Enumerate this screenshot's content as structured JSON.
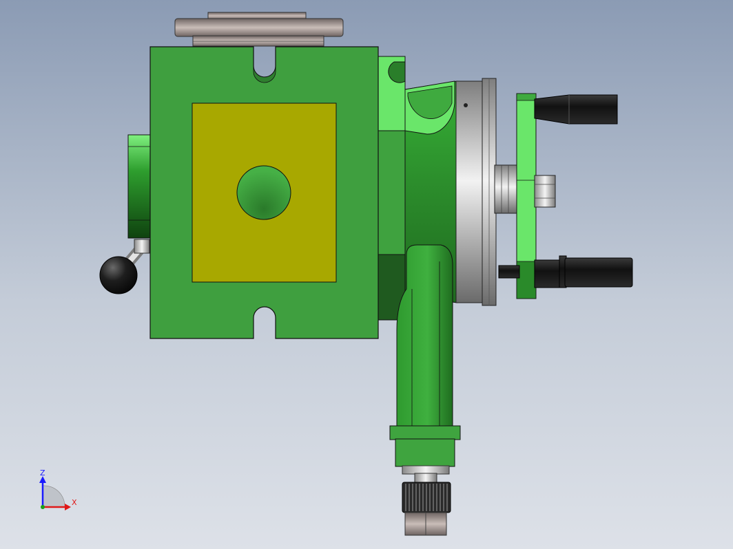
{
  "viewport": {
    "background_top": "#8b9bb4",
    "background_bottom": "#dde1e8"
  },
  "model": {
    "colors": {
      "body_green": "#3f9f3f",
      "light_green": "#66e266",
      "dark_green": "#1f5f1f",
      "olive_face": "#a8a800",
      "steel": "#b9b9b9",
      "cast_grey": "#9a8f8a",
      "knob_black": "#1c1c1c"
    }
  },
  "triad": {
    "z_label": "Z",
    "x_label": "X",
    "z_color": "#1a1aff",
    "x_color": "#e01818",
    "y_color": "#18a018"
  }
}
